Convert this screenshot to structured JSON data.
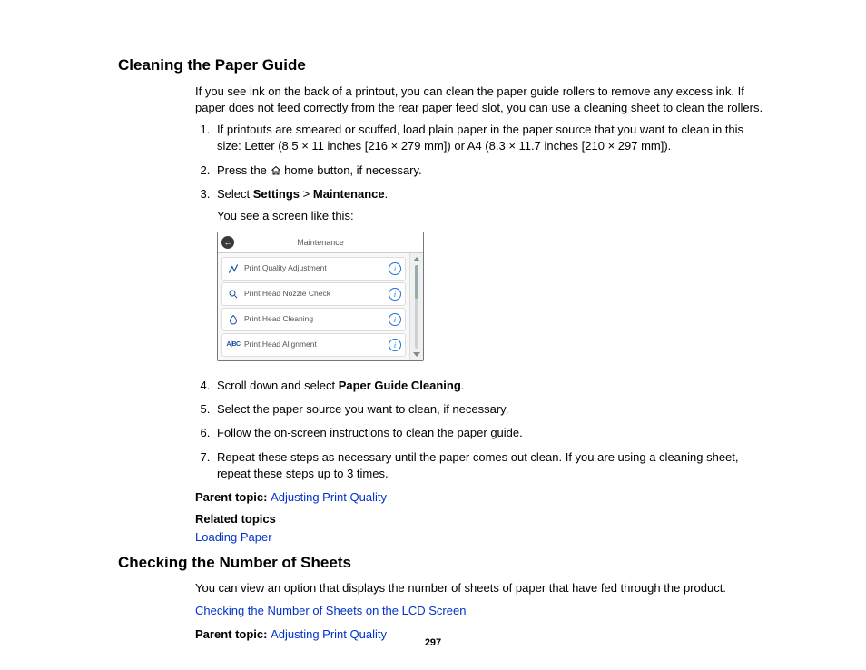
{
  "section1": {
    "heading": "Cleaning the Paper Guide",
    "intro": "If you see ink on the back of a printout, you can clean the paper guide rollers to remove any excess ink. If paper does not feed correctly from the rear paper feed slot, you can use a cleaning sheet to clean the rollers.",
    "step1": "If printouts are smeared or scuffed, load plain paper in the paper source that you want to clean in this size: Letter (8.5 × 11 inches [216 × 279 mm]) or A4 (8.3 × 11.7 inches [210 × 297 mm]).",
    "step2_pre": "Press the ",
    "step2_post": " home button, if necessary.",
    "step3_pre": "Select ",
    "step3_bold1": "Settings",
    "step3_mid": " > ",
    "step3_bold2": "Maintenance",
    "step3_post": ".",
    "step3_note": "You see a screen like this:",
    "step4_pre": "Scroll down and select ",
    "step4_bold": "Paper Guide Cleaning",
    "step4_post": ".",
    "step5": "Select the paper source you want to clean, if necessary.",
    "step6": "Follow the on-screen instructions to clean the paper guide.",
    "step7": "Repeat these steps as necessary until the paper comes out clean. If you are using a cleaning sheet, repeat these steps up to 3 times.",
    "parent_label": "Parent topic: ",
    "parent_link": "Adjusting Print Quality",
    "related_label": "Related topics",
    "related_link": "Loading Paper"
  },
  "device": {
    "title": "Maintenance",
    "rows": [
      {
        "label": "Print Quality Adjustment"
      },
      {
        "label": "Print Head Nozzle Check"
      },
      {
        "label": "Print Head Cleaning"
      },
      {
        "label": "Print Head Alignment"
      }
    ]
  },
  "section2": {
    "heading": "Checking the Number of Sheets",
    "intro": "You can view an option that displays the number of sheets of paper that have fed through the product.",
    "link": "Checking the Number of Sheets on the LCD Screen",
    "parent_label": "Parent topic: ",
    "parent_link": "Adjusting Print Quality"
  },
  "page_number": "297"
}
